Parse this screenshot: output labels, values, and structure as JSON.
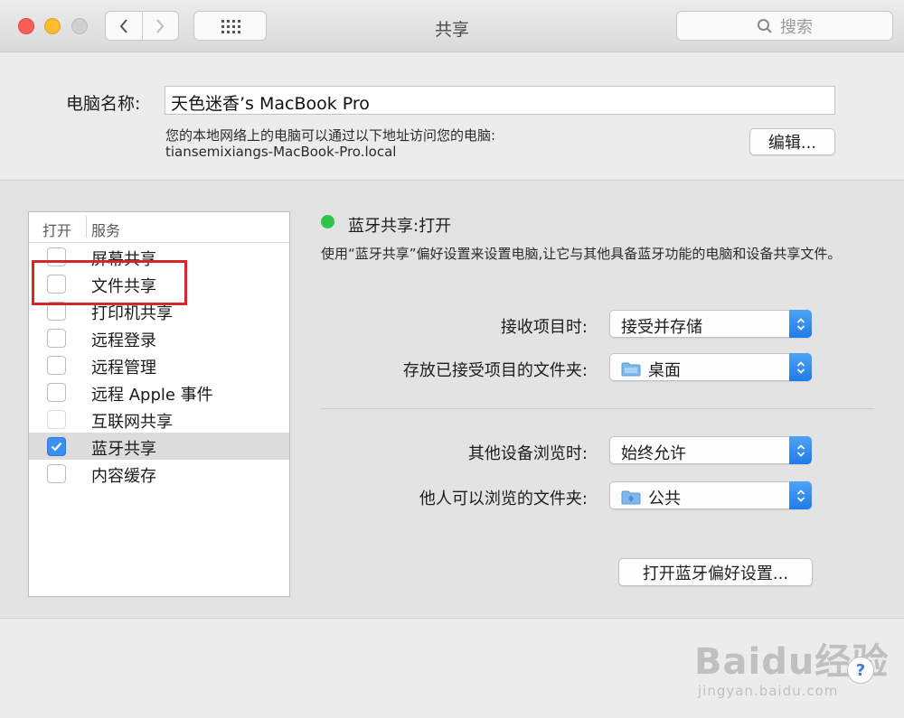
{
  "window": {
    "title": "共享"
  },
  "search": {
    "placeholder": "搜索"
  },
  "computer": {
    "name_label": "电脑名称:",
    "name_value": "天色迷香’s MacBook Pro",
    "address_note": "您的本地网络上的电脑可以通过以下地址访问您的电脑:",
    "address": "tiansemixiangs-MacBook-Pro.local",
    "edit_label": "编辑..."
  },
  "services": {
    "header_on": "打开",
    "header_service": "服务",
    "items": [
      {
        "label": "屏幕共享",
        "checked": false
      },
      {
        "label": "文件共享",
        "checked": false
      },
      {
        "label": "打印机共享",
        "checked": false
      },
      {
        "label": "远程登录",
        "checked": false
      },
      {
        "label": "远程管理",
        "checked": false
      },
      {
        "label": "远程 Apple 事件",
        "checked": false
      },
      {
        "label": "互联网共享",
        "checked": false
      },
      {
        "label": "蓝牙共享",
        "checked": true
      },
      {
        "label": "内容缓存",
        "checked": false
      }
    ]
  },
  "detail": {
    "status": "蓝牙共享:打开",
    "status_color": "#2fc44c",
    "description": "使用“蓝牙共享”偏好设置来设置电脑,让它与其他具备蓝牙功能的电脑和设备共享文件。",
    "receive_label": "接收项目时:",
    "receive_value": "接受并存储",
    "folder_label": "存放已接受项目的文件夹:",
    "folder_value": "桌面",
    "browse_label": "其他设备浏览时:",
    "browse_value": "始终允许",
    "browse_folder_label": "他人可以浏览的文件夹:",
    "browse_folder_value": "公共",
    "open_prefs_label": "打开蓝牙偏好设置..."
  },
  "watermark": {
    "logo": "Baidu经验",
    "sub": "jingyan.baidu.com"
  },
  "help": {
    "label": "?"
  },
  "colors": {
    "accent": "#3a8ff0",
    "highlight": "#d5262b"
  }
}
